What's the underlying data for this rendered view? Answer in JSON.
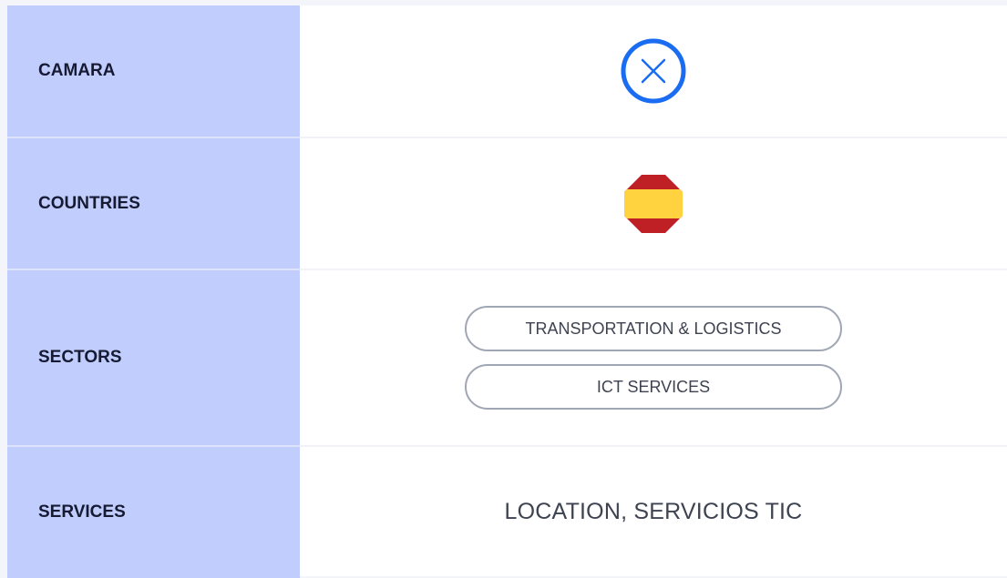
{
  "rows": {
    "camara": {
      "label": "CAMARA",
      "icon": "close-circle-icon",
      "icon_color": "#1a6cf2"
    },
    "countries": {
      "label": "COUNTRIES",
      "icon": "spain-flag-icon",
      "flag_colors": [
        "#bf2026",
        "#ffd23f"
      ]
    },
    "sectors": {
      "label": "SECTORS",
      "items": [
        "TRANSPORTATION & LOGISTICS",
        "ICT SERVICES"
      ]
    },
    "services": {
      "label": "SERVICES",
      "value": "LOCATION, SERVICIOS TIC"
    }
  },
  "colors": {
    "label_bg": "#c1cdfc",
    "label_text": "#161b33",
    "pill_border": "#a0a6b4",
    "value_text": "#3e4352"
  }
}
